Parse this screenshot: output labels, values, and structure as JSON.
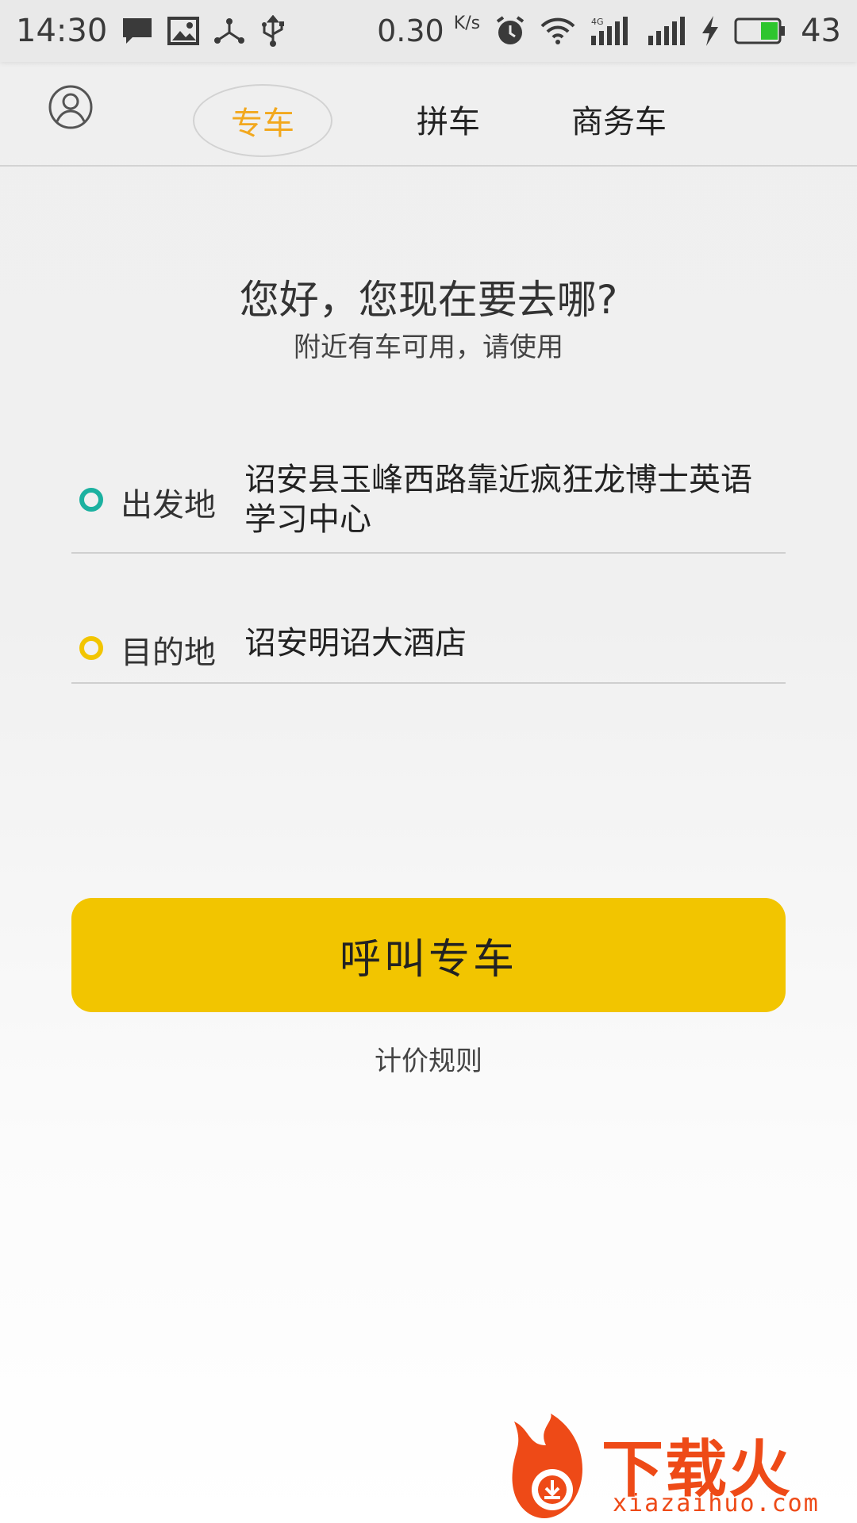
{
  "status_bar": {
    "time": "14:30",
    "net_speed": "0.30",
    "net_speed_unit": "K/s",
    "net_type": "4G",
    "battery": "43",
    "icons": [
      "message-icon",
      "image-icon",
      "share-icon",
      "usb-icon",
      "alarm-icon",
      "wifi-icon",
      "signal-icon",
      "signal-icon",
      "charging-icon",
      "battery-icon"
    ]
  },
  "nav": {
    "tabs": [
      {
        "label": "专车",
        "active": true
      },
      {
        "label": "拼车",
        "active": false
      },
      {
        "label": "商务车",
        "active": false
      }
    ]
  },
  "greeting": {
    "title": "您好，您现在要去哪?",
    "subtitle": "附近有车可用，请使用"
  },
  "origin": {
    "label": "出发地",
    "value": "诏安县玉峰西路靠近疯狂龙博士英语学习中心",
    "dot_color": "#1bb1a0"
  },
  "destination": {
    "label": "目的地",
    "value": "诏安明诏大酒店",
    "dot_color": "#f2c500"
  },
  "call_button": {
    "label": "呼叫专车",
    "color": "#f2c500"
  },
  "pricing_link": "计价规则",
  "watermark": {
    "text": "下载火",
    "url": "xiazaihuo.com",
    "color": "#ee4a17"
  }
}
